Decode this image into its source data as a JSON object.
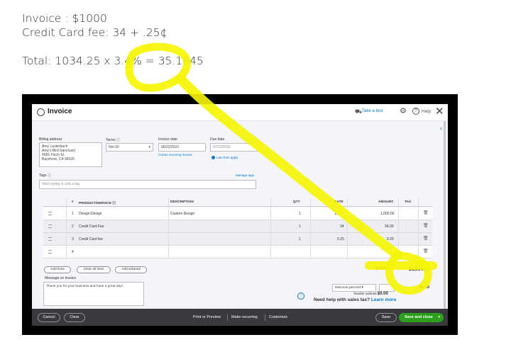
{
  "notes": {
    "line1": "Invoice : $1000",
    "line2": "Credit Card fee: 34 + .25¢",
    "line3": "Total: 1034.25 x 3.4% = 35.1645"
  },
  "app": {
    "title": "Invoice",
    "take_tour": "Take a tour",
    "help": "Help"
  },
  "form": {
    "billing_label": "Billing address",
    "billing_lines": [
      "Amy Lauterbach",
      "Amy's Bird Sanctuary",
      "4581 Finch St.",
      "Bayshore, CA 94326"
    ],
    "terms_label": "Terms",
    "terms_value": "Net 30",
    "invoice_date_label": "Invoice date",
    "invoice_date_value": "06/22/2022",
    "create_recurring": "Create recurring invoice",
    "due_date_label": "Due date",
    "due_date_value": "07/22/2022",
    "late_fees": "Late fees apply",
    "tags_label": "Tags",
    "manage_tags": "Manage tags",
    "tags_placeholder": "Start typing to add a tag"
  },
  "table": {
    "headers": [
      "#",
      "PRODUCT/SERVICE",
      "DESCRIPTION",
      "QTY",
      "RATE",
      "AMOUNT",
      "TAX"
    ],
    "rows": [
      {
        "num": "1",
        "product": "Design:Design",
        "description": "Custom Design",
        "qty": "1",
        "rate": "1,000",
        "amount": "1,000.00"
      },
      {
        "num": "2",
        "product": "Credit Card Fee",
        "description": "",
        "qty": "1",
        "rate": "34",
        "amount": "34.00"
      },
      {
        "num": "3",
        "product": "Credit Card fee",
        "description": "",
        "qty": "1",
        "rate": "0.25",
        "amount": "0.25"
      },
      {
        "num": "4",
        "product": "",
        "description": "",
        "qty": "",
        "rate": "",
        "amount": ""
      }
    ]
  },
  "actions": {
    "add_lines": "Add lines",
    "clear_all_lines": "Clear all lines",
    "add_subtotal": "Add subtotal"
  },
  "totals": {
    "subtotal_label": "Subtotal",
    "subtotal_value": "$1,034.25",
    "discount_option": "Discount percent",
    "discount_value": "$0.00",
    "taxable_label": "Taxable subtotal",
    "taxable_value": "$0.00",
    "need_help": "Need help with sales tax?",
    "learn_more": "Learn more"
  },
  "message": {
    "label": "Message on invoice",
    "text": "Thank you for your business and have a great day!"
  },
  "footer": {
    "cancel": "Cancel",
    "clear": "Clear",
    "print": "Print or Preview",
    "recurring": "Make recurring",
    "customize": "Customize",
    "save": "Save",
    "save_close": "Save and close"
  },
  "colors": {
    "highlight": "#f5f500",
    "accent": "#0077c5",
    "save_green": "#2ca01c",
    "footer_bg": "#393a3d"
  }
}
